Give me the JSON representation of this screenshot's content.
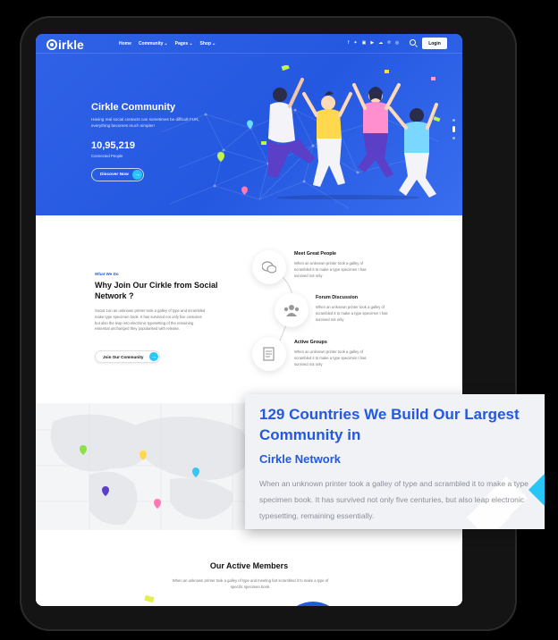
{
  "nav": {
    "logo": "irkle",
    "items": [
      {
        "label": "Home",
        "has_dropdown": false
      },
      {
        "label": "Community",
        "has_dropdown": true
      },
      {
        "label": "Pages",
        "has_dropdown": true
      },
      {
        "label": "Shop",
        "has_dropdown": true
      }
    ],
    "social_icons": [
      "facebook-icon",
      "twitter-icon",
      "linkedin-icon",
      "youtube-icon",
      "soundcloud-icon",
      "pinterest-icon",
      "instagram-icon"
    ],
    "login_label": "Login"
  },
  "hero": {
    "title": "Cirkle Community",
    "description": "Having real social contacts can sometimes be difficult FUN, everything becomes much simpler!",
    "count": "10,95,219",
    "count_label": "Connected People",
    "cta_label": "Discover Now"
  },
  "why": {
    "kicker": "What We Do",
    "title": "Why Join Our Cirkle from Social Network ?",
    "description": "Social 1un an unknown printer took a galley of type and scrambled make type specimen book. It has survived not only five centuries but also the leap into electronic typesetting of the remaining essential unchanged they popularised with release.",
    "cta_label": "Join Our Community",
    "features": [
      {
        "title": "Meet Great People",
        "desc": "When an unknown printer took a galley of scrambled it to make a type specimen t has survived not only",
        "icon": "chat-bubbles-icon"
      },
      {
        "title": "Forum Discussion",
        "desc": "When an unknown printer took a galley of scrambled it to make a type specimen t has survived not only",
        "icon": "group-icon"
      },
      {
        "title": "Active Groups",
        "desc": "When an unknown printer took a galley of scrambled it to make a type specimen t has survived not only",
        "icon": "document-icon"
      }
    ]
  },
  "map_card": {
    "title": "129 Countries We Build Our Largest Community in",
    "subtitle": "Cirkle Network",
    "description": "When an unknown printer took a galley of type and scrambled it to make a type specimen book. It has survived not only five centuries, but also leap electronic typesetting, remaining essentially."
  },
  "members": {
    "title": "Our Active Members",
    "description": "When an unknown printer took a galley of type and meeting fart scrambled it to make a type of specific specimen book."
  },
  "colors": {
    "brand_blue": "#2458e0",
    "accent_cyan": "#26c6f9"
  }
}
